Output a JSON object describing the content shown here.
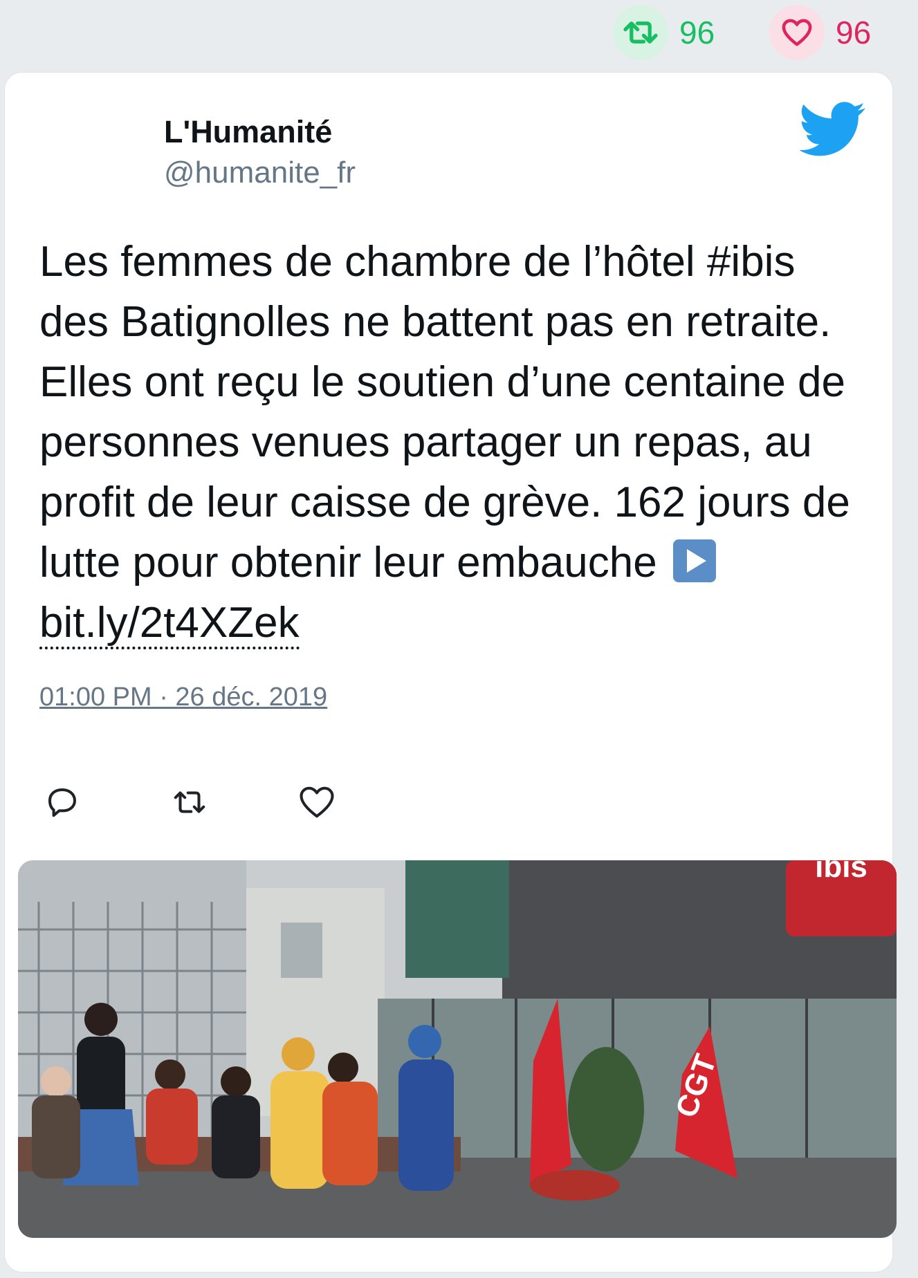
{
  "stats": {
    "retweets": "96",
    "likes": "96",
    "colors": {
      "retweet": "#17bf63",
      "like": "#e0245e"
    }
  },
  "author": {
    "name": "L'Humanité",
    "handle": "@humanite_fr"
  },
  "tweet": {
    "text": "Les femmes de chambre de l’hôtel #ibis des Batignolles ne battent pas en retraite. Elles ont reçu le soutien d’une centaine de personnes venues partager un repas, au profit de leur caisse de grève. 162 jours de lutte pour obtenir leur embauche ",
    "emoji": "play-button",
    "link": "bit.ly/2t4XZek",
    "timestamp": "01:00 PM · 26 déc. 2019"
  },
  "actions": [
    "reply-icon",
    "retweet-icon",
    "like-icon"
  ],
  "media": {
    "sign_text": "ibis",
    "flag_text": "CGT"
  },
  "brand": {
    "icon": "twitter-bird-icon",
    "color": "#1da1f2"
  }
}
